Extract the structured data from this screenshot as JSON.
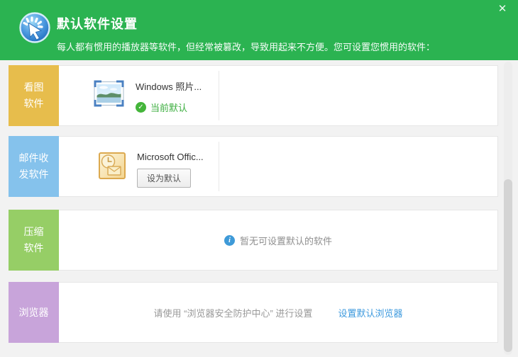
{
  "icons": {
    "close": "✕",
    "check": "✓",
    "info": "i"
  },
  "header": {
    "title": "默认软件设置",
    "subtitle": "每人都有惯用的播放器等软件，但经常被篡改，导致用起来不方便。您可设置您惯用的软件：",
    "bg_color": "#2bb351"
  },
  "rows": [
    {
      "label_lines": [
        "看图",
        "软件"
      ],
      "label_color": "#e7bd4c",
      "item": {
        "name": "Windows 照片...",
        "status": "当前默认"
      }
    },
    {
      "label_lines": [
        "邮件收",
        "发软件"
      ],
      "label_color": "#85c2ec",
      "item": {
        "name": "Microsoft Offic...",
        "action": "设为默认"
      }
    },
    {
      "label_lines": [
        "压缩",
        "软件"
      ],
      "label_color": "#96ce66",
      "empty_text": "暂无可设置默认的软件"
    },
    {
      "label_lines": [
        "浏览器"
      ],
      "label_color": "#c8a4da",
      "notice_text": "请使用 “浏览器安全防护中心” 进行设置",
      "link_text": "设置默认浏览器"
    }
  ]
}
